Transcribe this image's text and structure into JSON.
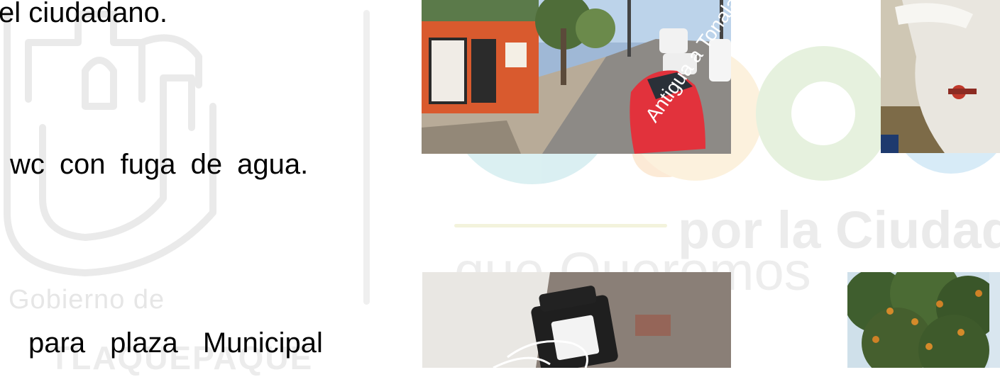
{
  "text_lines": {
    "line1": "el ciudadano.",
    "line2": "wc con fuga de agua.",
    "line3": "para plaza Municipal"
  },
  "watermark": {
    "gobierno": "Gobierno de",
    "city": "TLAQUEPAQUE",
    "slogan_por_la": "por la",
    "slogan_ciudad": "Ciudad",
    "slogan_que": "que Queremos"
  },
  "photos": {
    "street_sign": "Antigua a Tonala"
  },
  "colors": {
    "watermark_gray": "#e6e6e6",
    "text": "#000000",
    "car_red": "#e2323c",
    "wall_orange": "#d95a2e"
  }
}
